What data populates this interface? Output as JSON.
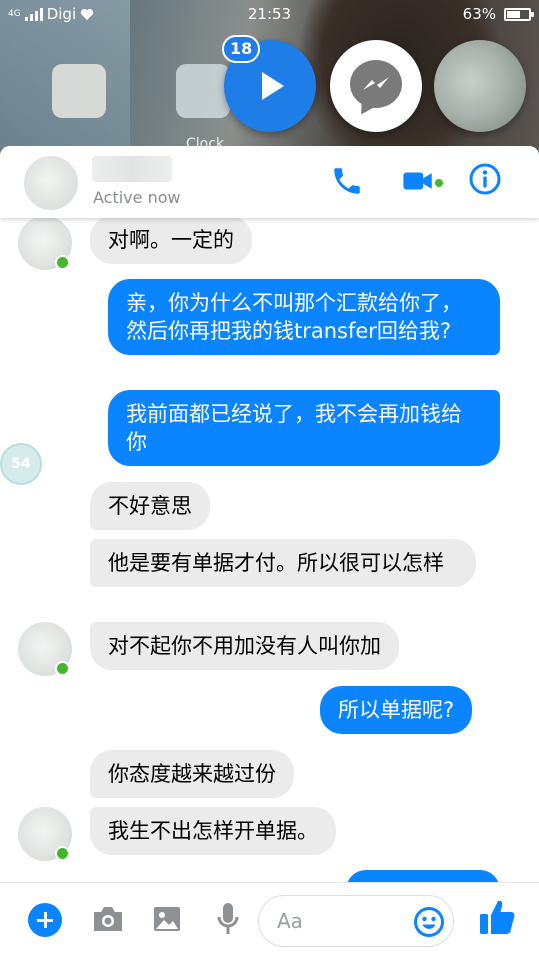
{
  "status_bar": {
    "carrier": "Digi",
    "time": "21:53",
    "battery": "63%",
    "battery_level": 0.63
  },
  "chat_heads": {
    "badge_count": "18",
    "background_app_label": "Clock"
  },
  "header": {
    "status": "Active now",
    "icons": [
      "phone-icon",
      "video-call-icon",
      "info-icon"
    ]
  },
  "messages": [
    {
      "dir": "in",
      "text": "对啊。一定的"
    },
    {
      "dir": "out",
      "text": "亲，你为什么不叫那个汇款给你了，然后你再把我的钱transfer回给我?"
    },
    {
      "dir": "out",
      "text": "我前面都已经说了，我不会再加钱给你"
    },
    {
      "dir": "in",
      "text": "不好意思"
    },
    {
      "dir": "in",
      "text": "他是要有单据才付。所以很可以怎样"
    },
    {
      "dir": "in",
      "text": "对不起你不用加没有人叫你加"
    },
    {
      "dir": "out",
      "text": "所以单据呢?"
    },
    {
      "dir": "in",
      "text": "你态度越来越过份"
    },
    {
      "dir": "in",
      "text": "我生不出怎样开单据。"
    }
  ],
  "seen_head": {
    "label": "54"
  },
  "composer": {
    "placeholder": "Aa",
    "icons": [
      "add-icon",
      "camera-icon",
      "gallery-icon",
      "microphone-icon",
      "emoji-icon",
      "thumbs-up-icon"
    ]
  },
  "colors": {
    "accent": "#0a84ff",
    "incoming_bubble": "#ebebeb",
    "online": "#42b72a"
  }
}
